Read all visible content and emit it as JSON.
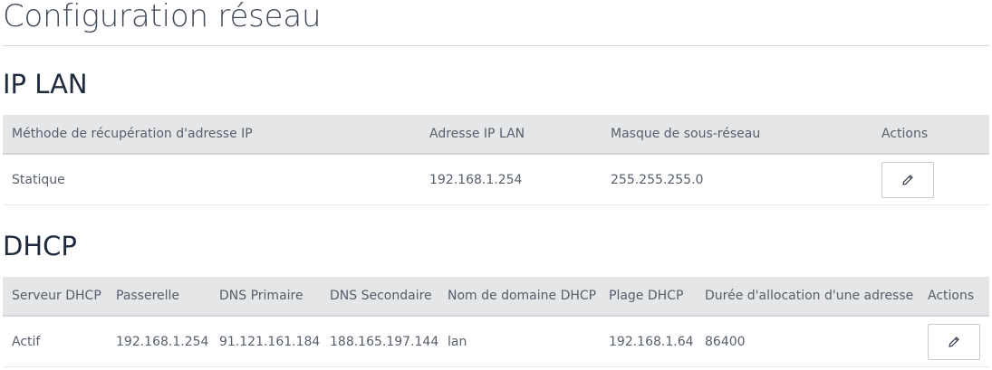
{
  "page": {
    "title": "Configuration réseau"
  },
  "ip_lan": {
    "section_title": "IP LAN",
    "columns": [
      "Méthode de récupération d'adresse IP",
      "Adresse IP LAN",
      "Masque de sous-réseau",
      "Actions"
    ],
    "rows": [
      {
        "method": "Statique",
        "ip_address": "192.168.1.254",
        "subnet_mask": "255.255.255.0",
        "action_icon": "pencil-icon"
      }
    ]
  },
  "dhcp": {
    "section_title": "DHCP",
    "columns": [
      "Serveur DHCP",
      "Passerelle",
      "DNS Primaire",
      "DNS Secondaire",
      "Nom de domaine DHCP",
      "Plage DHCP",
      "Durée d'allocation d'une adresse",
      "Actions"
    ],
    "rows": [
      {
        "server": "Actif",
        "gateway": "192.168.1.254",
        "dns_primary": "91.121.161.184",
        "dns_secondary": "188.165.197.144",
        "domain_name": "lan",
        "range": "192.168.1.64",
        "lease_duration": "86400",
        "action_icon": "pencil-icon"
      }
    ]
  },
  "colors": {
    "header_bg": "#e5e6e7",
    "text": "#555e6b",
    "heading": "#1e2a3d"
  }
}
